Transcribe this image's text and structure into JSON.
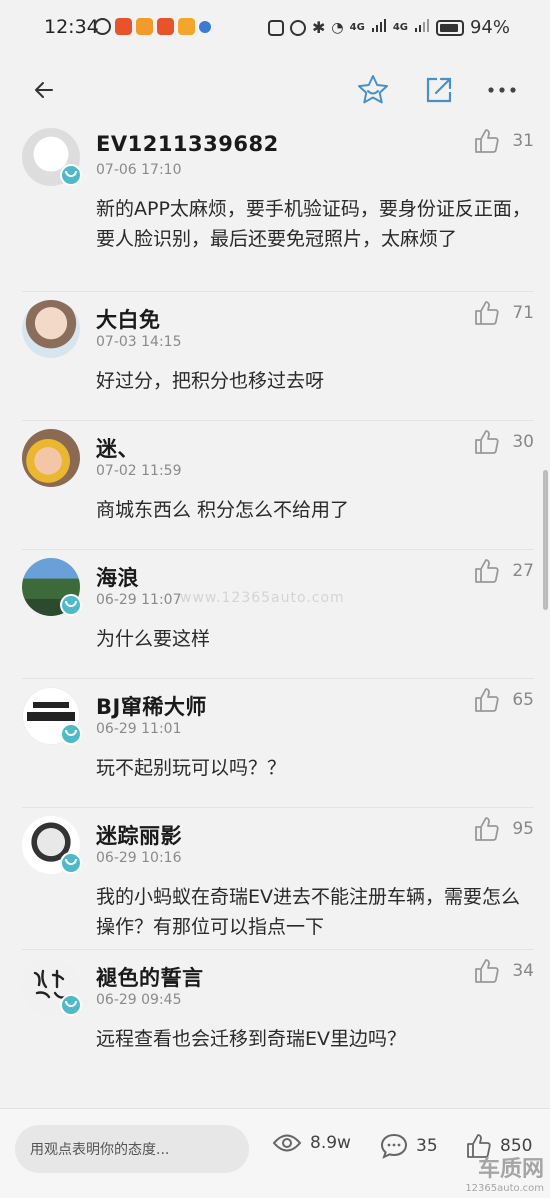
{
  "status_bar": {
    "time": "12:34",
    "network_1": "4G",
    "network_2": "4G",
    "battery": "94%"
  },
  "colors": {
    "accent": "#4a90c8",
    "badge": "#4fb9c9"
  },
  "comments": [
    {
      "name": "EV1211339682",
      "time": "07-06 17:10",
      "text": "新的APP太麻烦，要手机验证码，要身份证反正面，要人脸识别，最后还要免冠照片，太麻烦了",
      "likes": "31"
    },
    {
      "name": "大白免",
      "time": "07-03 14:15",
      "text": "好过分，把积分也移过去呀",
      "likes": "71"
    },
    {
      "name": "迷、",
      "time": "07-02 11:59",
      "text": "商城东西么 积分怎么不给用了",
      "likes": "30"
    },
    {
      "name": "海浪",
      "time": "06-29 11:07",
      "text": "为什么要这样",
      "likes": "27"
    },
    {
      "name": "BJ窜稀大师",
      "time": "06-29 11:01",
      "text": "玩不起别玩可以吗？？",
      "likes": "65"
    },
    {
      "name": "迷踪丽影",
      "time": "06-29 10:16",
      "text": "我的小蚂蚁在奇瑞EV进去不能注册车辆，需要怎么操作？有那位可以指点一下",
      "likes": "95"
    },
    {
      "name": "褪色的誓言",
      "time": "06-29 09:45",
      "text": "远程查看也会迁移到奇瑞EV里边吗？",
      "likes": "34"
    }
  ],
  "bottom_bar": {
    "input_placeholder": "用观点表明你的态度...",
    "views": "8.9w",
    "comments": "35",
    "likes": "850"
  },
  "watermark": {
    "center": "www.12365auto.com",
    "corner_title": "车质网",
    "corner_url": "12365auto.com"
  }
}
